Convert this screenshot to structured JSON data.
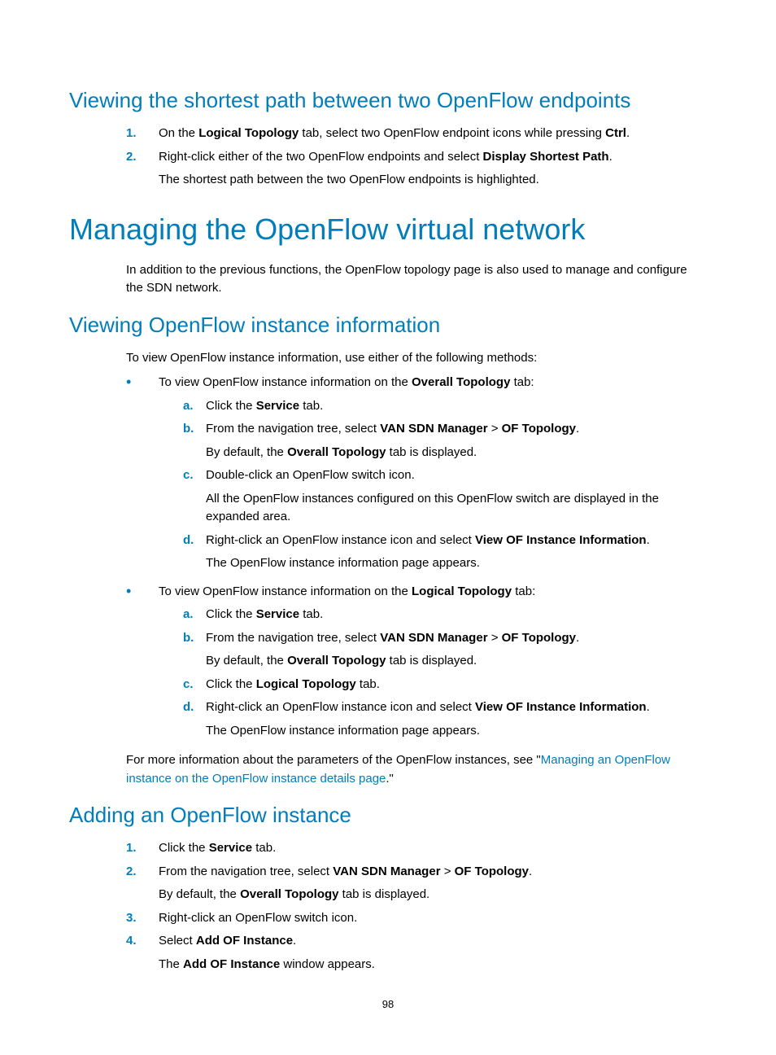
{
  "section1": {
    "heading": "Viewing the shortest path between two OpenFlow endpoints",
    "steps": [
      {
        "num": "1.",
        "pre": "On the ",
        "b1": "Logical Topology",
        "mid": " tab, select two OpenFlow endpoint icons while pressing ",
        "b2": "Ctrl",
        "post": "."
      },
      {
        "num": "2.",
        "pre": "Right-click either of the two OpenFlow endpoints and select ",
        "b1": "Display Shortest Path",
        "post": ".",
        "sub": "The shortest path between the two OpenFlow endpoints is highlighted."
      }
    ]
  },
  "section2": {
    "heading": "Managing the OpenFlow virtual network",
    "intro": "In addition to the previous functions, the OpenFlow topology page is also used to manage and configure the SDN network."
  },
  "section3": {
    "heading": "Viewing OpenFlow instance information",
    "intro": "To view OpenFlow instance information, use either of the following methods:",
    "bullets": [
      {
        "pre": "To view OpenFlow instance information on the ",
        "b1": "Overall Topology",
        "post": " tab:",
        "steps": [
          {
            "let": "a.",
            "pre": "Click the ",
            "b1": "Service",
            "post": " tab."
          },
          {
            "let": "b.",
            "pre": "From the navigation tree, select ",
            "b1": "VAN SDN Manager",
            "mid": " > ",
            "b2": "OF Topology",
            "post": ".",
            "subPre": "By default, the ",
            "subB": "Overall Topology",
            "subPost": " tab is displayed."
          },
          {
            "let": "c.",
            "pre": "Double-click an OpenFlow switch icon.",
            "sub": "All the OpenFlow instances configured on this OpenFlow switch are displayed in the expanded area."
          },
          {
            "let": "d.",
            "pre": "Right-click an OpenFlow instance icon and select ",
            "b1": "View OF Instance Information",
            "post": ".",
            "sub": "The OpenFlow instance information page appears."
          }
        ]
      },
      {
        "pre": "To view OpenFlow instance information on the ",
        "b1": "Logical Topology",
        "post": " tab:",
        "steps": [
          {
            "let": "a.",
            "pre": "Click the ",
            "b1": "Service",
            "post": " tab."
          },
          {
            "let": "b.",
            "pre": "From the navigation tree, select ",
            "b1": "VAN SDN Manager",
            "mid": " > ",
            "b2": "OF Topology",
            "post": ".",
            "subPre": "By default, the ",
            "subB": "Overall Topology",
            "subPost": " tab is displayed."
          },
          {
            "let": "c.",
            "pre": "Click the ",
            "b1": "Logical Topology",
            "post": " tab."
          },
          {
            "let": "d.",
            "pre": "Right-click an OpenFlow instance icon and select ",
            "b1": "View OF Instance Information",
            "post": ".",
            "sub": "The OpenFlow instance information page appears."
          }
        ]
      }
    ],
    "outro": {
      "pre": "For more information about the parameters of the OpenFlow instances, see \"",
      "link": "Managing an OpenFlow instance on the OpenFlow instance details page",
      "post": ".\""
    }
  },
  "section4": {
    "heading": "Adding an OpenFlow instance",
    "steps": [
      {
        "num": "1.",
        "pre": "Click the ",
        "b1": "Service",
        "post": " tab."
      },
      {
        "num": "2.",
        "pre": "From the navigation tree, select ",
        "b1": "VAN SDN Manager",
        "mid": " > ",
        "b2": "OF Topology",
        "post": ".",
        "subPre": "By default, the ",
        "subB": "Overall Topology",
        "subPost": " tab is displayed."
      },
      {
        "num": "3.",
        "pre": "Right-click an OpenFlow switch icon."
      },
      {
        "num": "4.",
        "pre": "Select ",
        "b1": "Add OF Instance",
        "post": ".",
        "subPre": "The ",
        "subB": "Add OF Instance",
        "subPost": " window appears."
      }
    ]
  },
  "pageNumber": "98"
}
